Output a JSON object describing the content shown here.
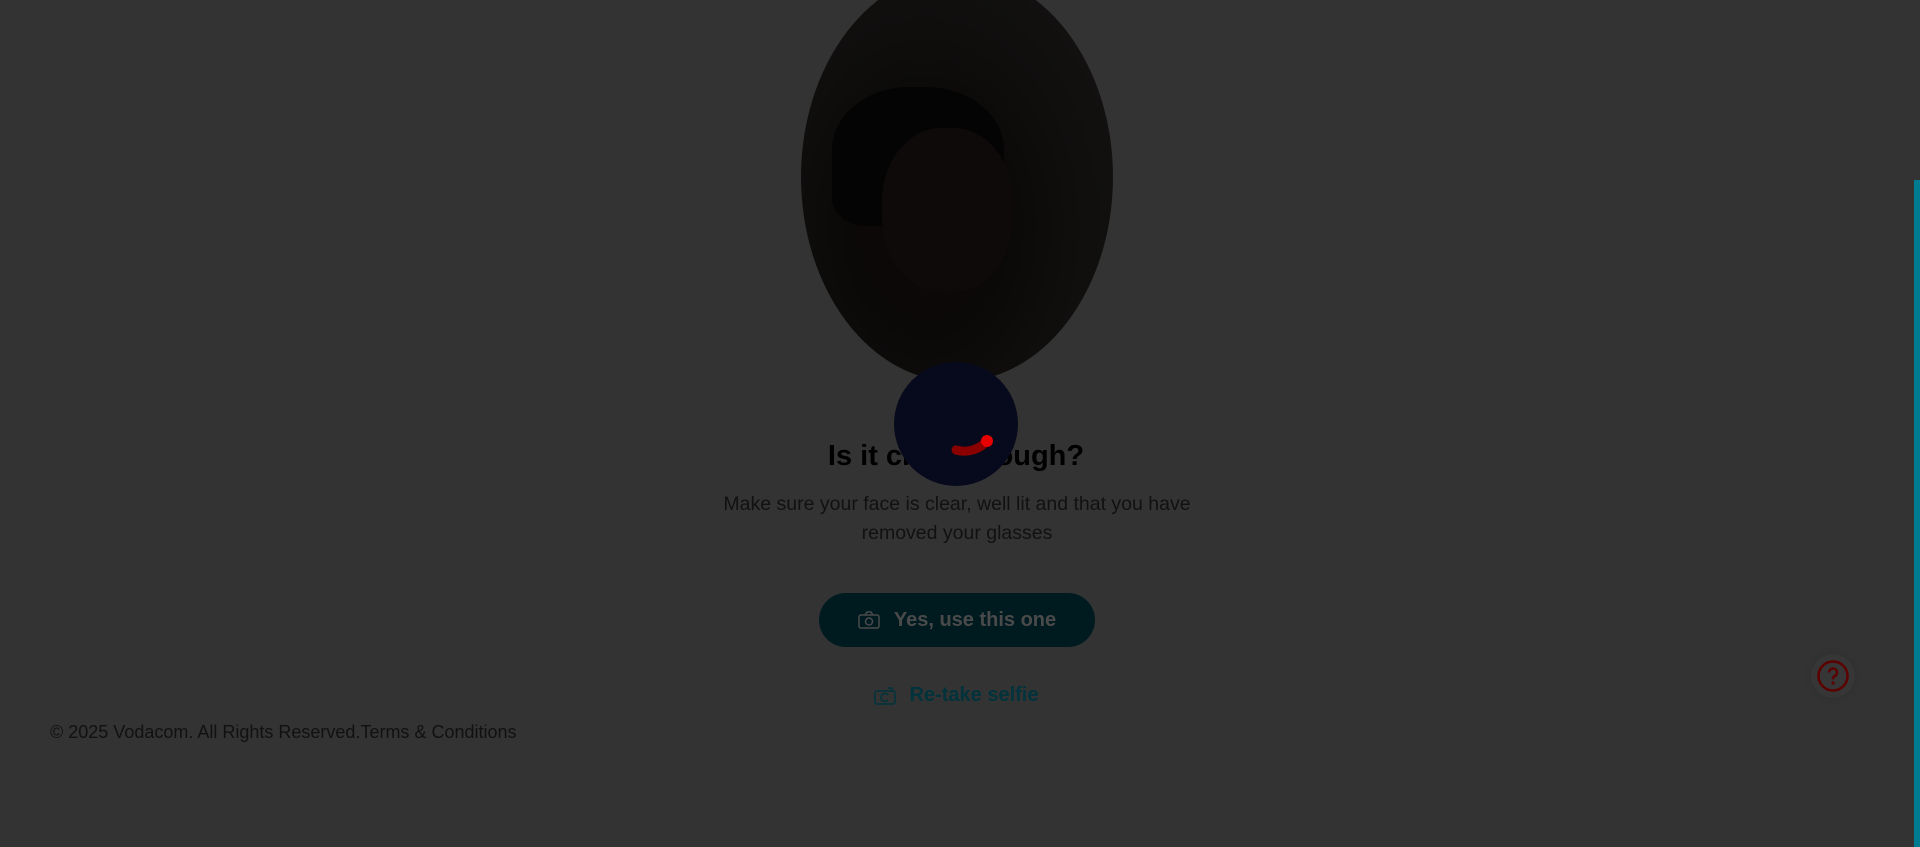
{
  "selfie": {
    "shape": "oval",
    "alt_icon": "selfie-photo"
  },
  "review": {
    "title": "Is it clear enough?",
    "subtitle": "Make sure your face is clear, well lit and that you have removed your glasses"
  },
  "actions": {
    "confirm_label": "Yes, use this one",
    "confirm_icon": "camera-icon",
    "retake_label": "Re-take selfie",
    "retake_icon": "camera-retake-icon"
  },
  "footer": {
    "copyright": "© 2025 Vodacom. All Rights Reserved.",
    "terms_link": "Terms & Conditions"
  },
  "help": {
    "icon": "question-circle-icon"
  },
  "loading": {
    "state": "spinner"
  },
  "colors": {
    "brand_teal": "#00879f",
    "brand_red": "#e60000",
    "overlay": "rgba(0,0,0,0.8)"
  }
}
